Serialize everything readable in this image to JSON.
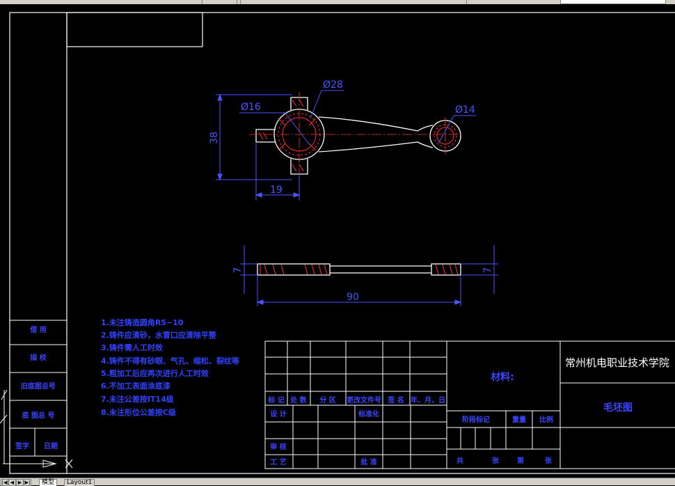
{
  "window": {
    "layout_tabs": [
      "模型",
      "Layout1"
    ]
  },
  "colors": {
    "background": "#000000",
    "outline": "#ffffff",
    "dimension": "#4a55ff",
    "center_line": "#ff3030",
    "hatch": "#ff3030",
    "notes": "#2f42ff",
    "title_text": "#3a46ff",
    "ucs_icon": "#ffffff"
  },
  "drawing": {
    "dims": {
      "d_big": "Ø28",
      "d_bore": "Ø16",
      "d_small": "Ø14",
      "height": "38",
      "offset": "19",
      "thickness_left": "7",
      "thickness_right": "7",
      "length": "90"
    }
  },
  "notes": [
    "1.未注铸造圆角R5−10",
    "2.铸件应清砂，水冒口应清除平整",
    "3.铸件需人工时效",
    "4.铸件不得有砂眼、气孔、缩松、裂纹等",
    "5.粗加工后应再次进行人工时效",
    "6.不加工表面涂底漆",
    "7.未注公差按IT14级",
    "8.未注形位公差按C级"
  ],
  "sidebar_labels": [
    "借 用",
    "描 校",
    "旧底图总号",
    "底 图总 号",
    "签字",
    "日期"
  ],
  "title_block": {
    "school": "常州机电职业技术学院",
    "drawing_name": "毛坯图",
    "material_label": "材料:",
    "header_row": [
      "标 记",
      "处 数",
      "分 区",
      "更改文件号",
      "签 名",
      "年、月、日"
    ],
    "design": "设 计",
    "standardize": "标准化",
    "review": "审 核",
    "process": "工 艺",
    "approve": "批 准",
    "stage_mark": "阶段标记",
    "weight": "重量",
    "scale": "比例",
    "total": "共",
    "sheets": "张",
    "page": "第",
    "sheet_unit": "张"
  }
}
